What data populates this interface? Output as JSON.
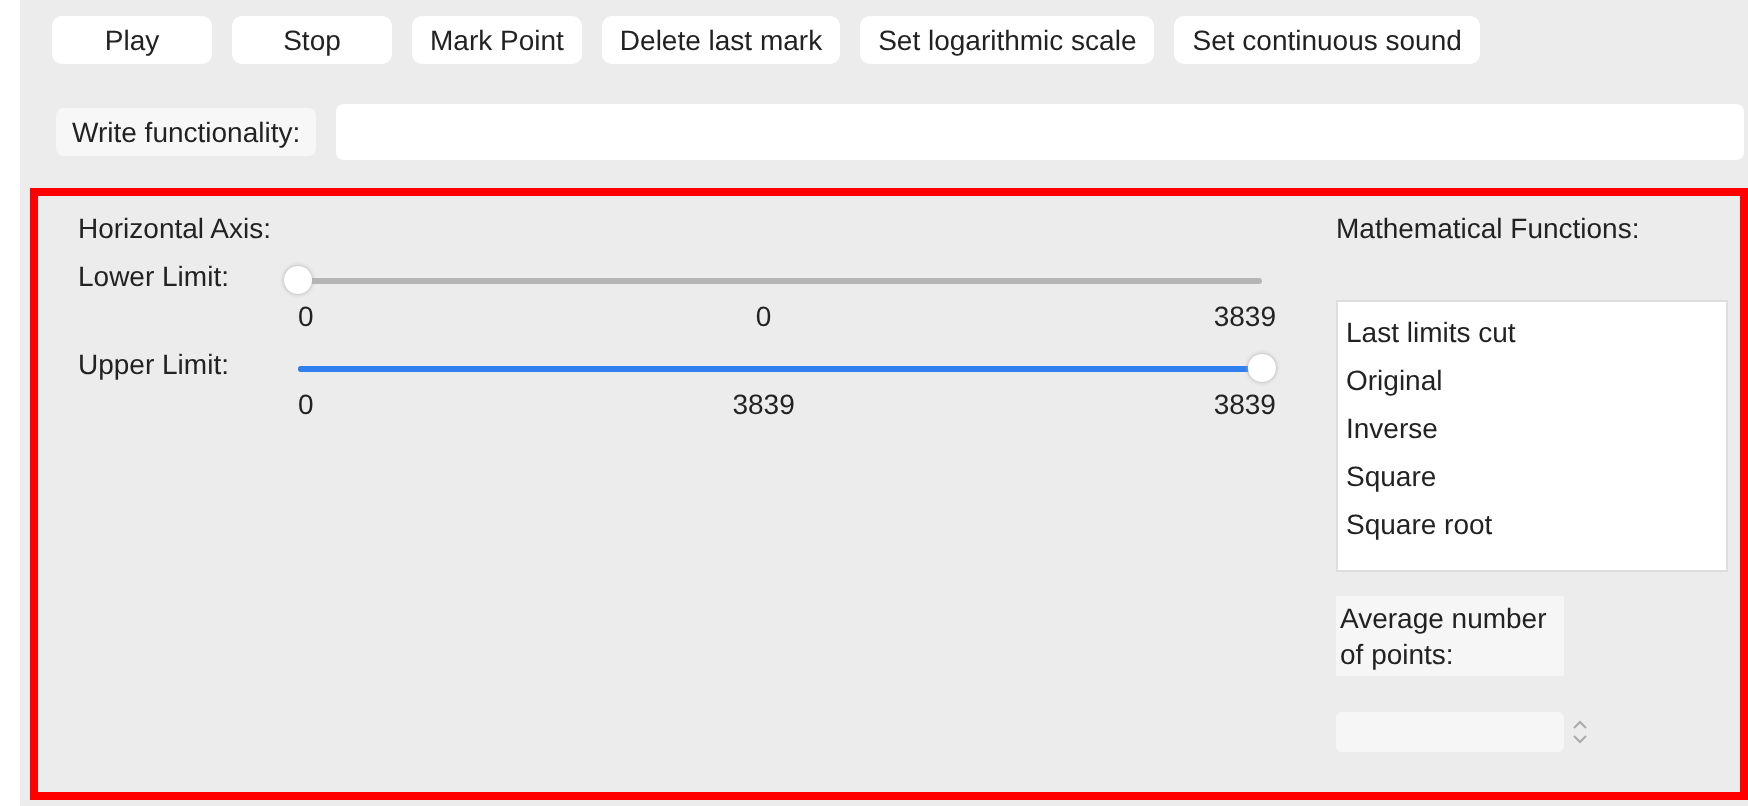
{
  "toolbar": {
    "buttons": [
      "Play",
      "Stop",
      "Mark Point",
      "Delete last mark",
      "Set logarithmic scale",
      "Set continuous sound"
    ]
  },
  "functionality": {
    "label": "Write functionality:"
  },
  "horizontal_axis": {
    "title": "Horizontal Axis:",
    "sliders": [
      {
        "label": "Lower Limit:",
        "level": 0,
        "min": "0",
        "value": "0",
        "max": "3839",
        "active": false
      },
      {
        "label": "Upper Limit:",
        "level": 1,
        "min": "0",
        "value": "3839",
        "max": "3839",
        "active": true
      }
    ]
  },
  "math_functions": {
    "title": "Mathematical Functions:",
    "items": [
      {
        "label": "Last limits cut",
        "selected": false
      },
      {
        "label": "Original",
        "selected": false
      },
      {
        "label": "Inverse",
        "selected": false
      },
      {
        "label": "Square",
        "selected": false
      },
      {
        "label": "Square root",
        "selected": false
      }
    ]
  },
  "average": {
    "label": "Average number of points:"
  }
}
